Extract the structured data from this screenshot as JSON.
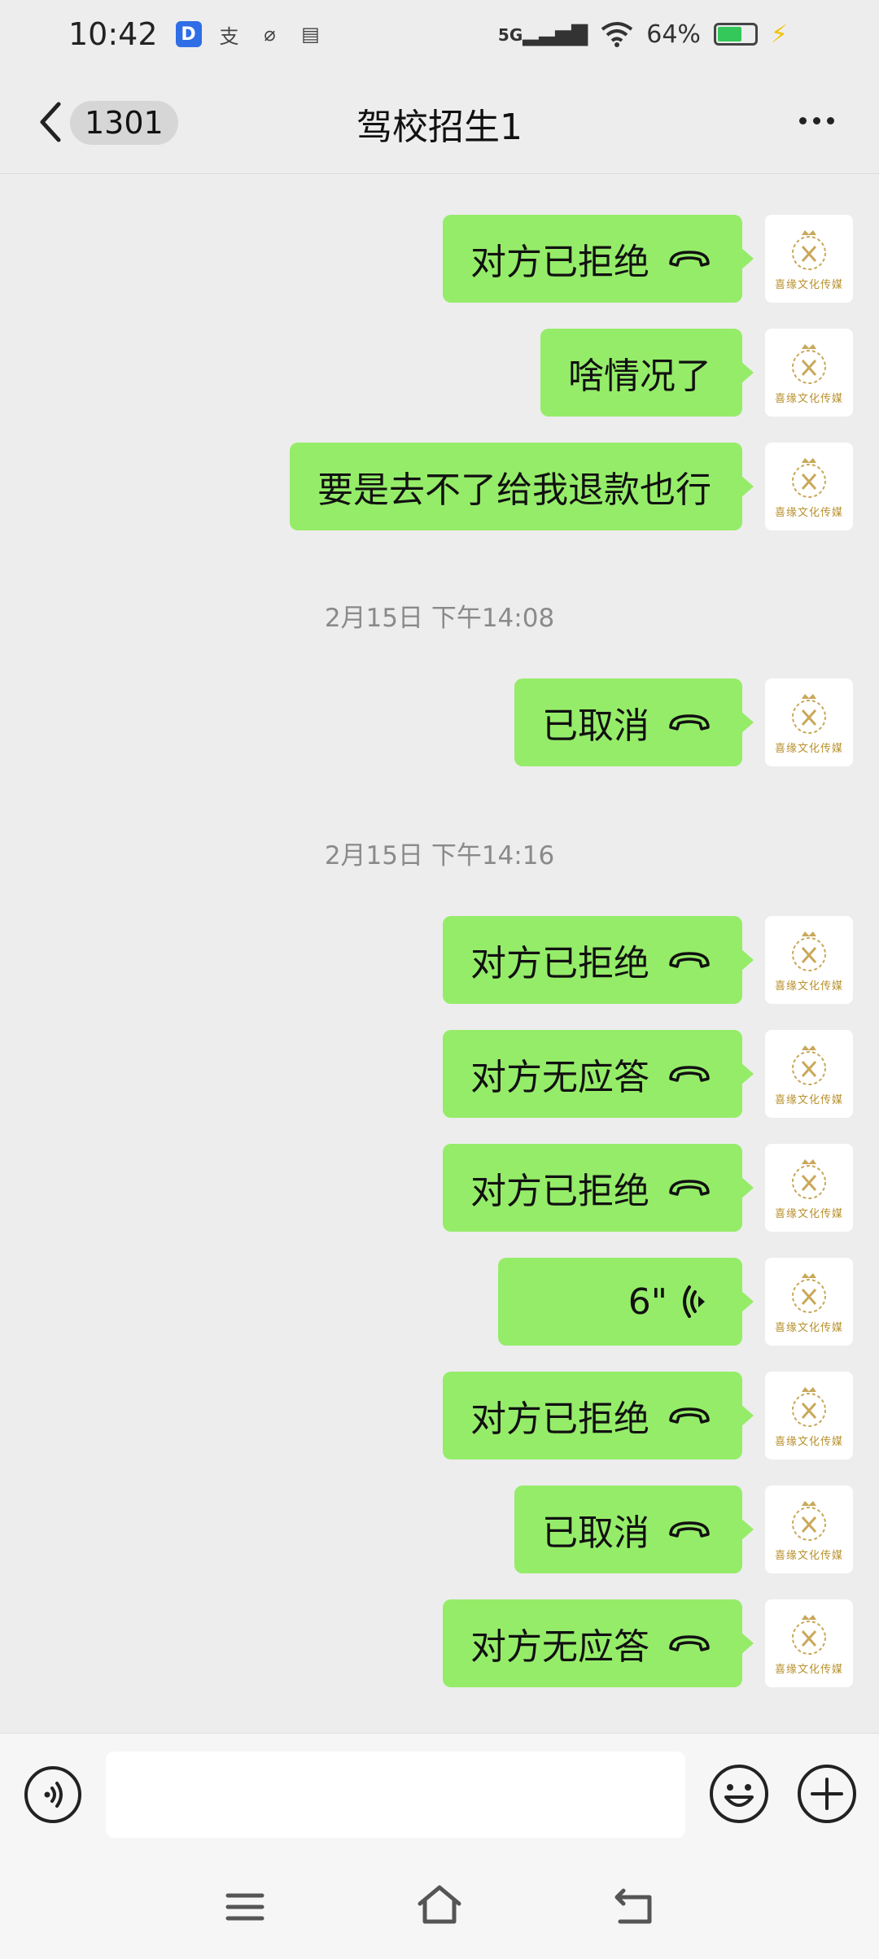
{
  "status_bar": {
    "time": "10:42",
    "app_icons": [
      "dingtalk-icon",
      "alipay-icon",
      "link-icon",
      "wallet-icon"
    ],
    "signal_label": "5G",
    "battery_percent": "64%",
    "battery_level": 0.64
  },
  "header": {
    "unread_count": "1301",
    "title": "驾校招生1"
  },
  "avatar": {
    "brand_text": "喜缘文化传媒",
    "accent_color": "#c9a85a"
  },
  "colors": {
    "bubble": "#95ec69",
    "background": "#ededed"
  },
  "messages": [
    {
      "kind": "call",
      "text": "对方已拒绝",
      "icon": "hangup-icon"
    },
    {
      "kind": "text",
      "text": "啥情况了"
    },
    {
      "kind": "text",
      "text": "要是去不了给我退款也行"
    },
    {
      "kind": "time",
      "text": "2月15日 下午14:08"
    },
    {
      "kind": "call",
      "text": "已取消",
      "icon": "hangup-icon"
    },
    {
      "kind": "time",
      "text": "2月15日 下午14:16"
    },
    {
      "kind": "call",
      "text": "对方已拒绝",
      "icon": "hangup-icon"
    },
    {
      "kind": "call",
      "text": "对方无应答",
      "icon": "hangup-icon"
    },
    {
      "kind": "call",
      "text": "对方已拒绝",
      "icon": "hangup-icon"
    },
    {
      "kind": "voice",
      "text": "6\"",
      "icon": "voice-message-icon"
    },
    {
      "kind": "call",
      "text": "对方已拒绝",
      "icon": "hangup-icon"
    },
    {
      "kind": "call",
      "text": "已取消",
      "icon": "hangup-icon"
    },
    {
      "kind": "call",
      "text": "对方无应答",
      "icon": "hangup-icon"
    }
  ],
  "input": {
    "value": ""
  }
}
